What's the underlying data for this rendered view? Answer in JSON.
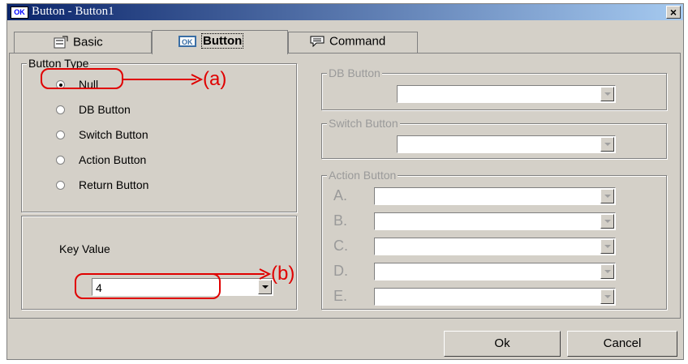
{
  "window": {
    "title": "Button - Button1",
    "title_icon": "OK"
  },
  "tabs": [
    {
      "label": "Basic",
      "icon": "properties-icon"
    },
    {
      "label": "Button",
      "icon": "ok-button-icon"
    },
    {
      "label": "Command",
      "icon": "speech-bubble-icon"
    }
  ],
  "button_type": {
    "legend": "Button Type",
    "options": [
      "Null",
      "DB Button",
      "Switch Button",
      "Action Button",
      "Return Button"
    ],
    "selected": "Null"
  },
  "key_value": {
    "label": "Key Value",
    "value": "4"
  },
  "db_button": {
    "legend": "DB Button",
    "value": ""
  },
  "switch_button": {
    "legend": "Switch Button",
    "value": ""
  },
  "action_button": {
    "legend": "Action Button",
    "rows": [
      "A.",
      "B.",
      "C.",
      "D.",
      "E."
    ]
  },
  "annotations": {
    "a": "(a)",
    "b": "(b)",
    "color": "#e00000"
  },
  "footer": {
    "ok": "Ok",
    "cancel": "Cancel"
  }
}
